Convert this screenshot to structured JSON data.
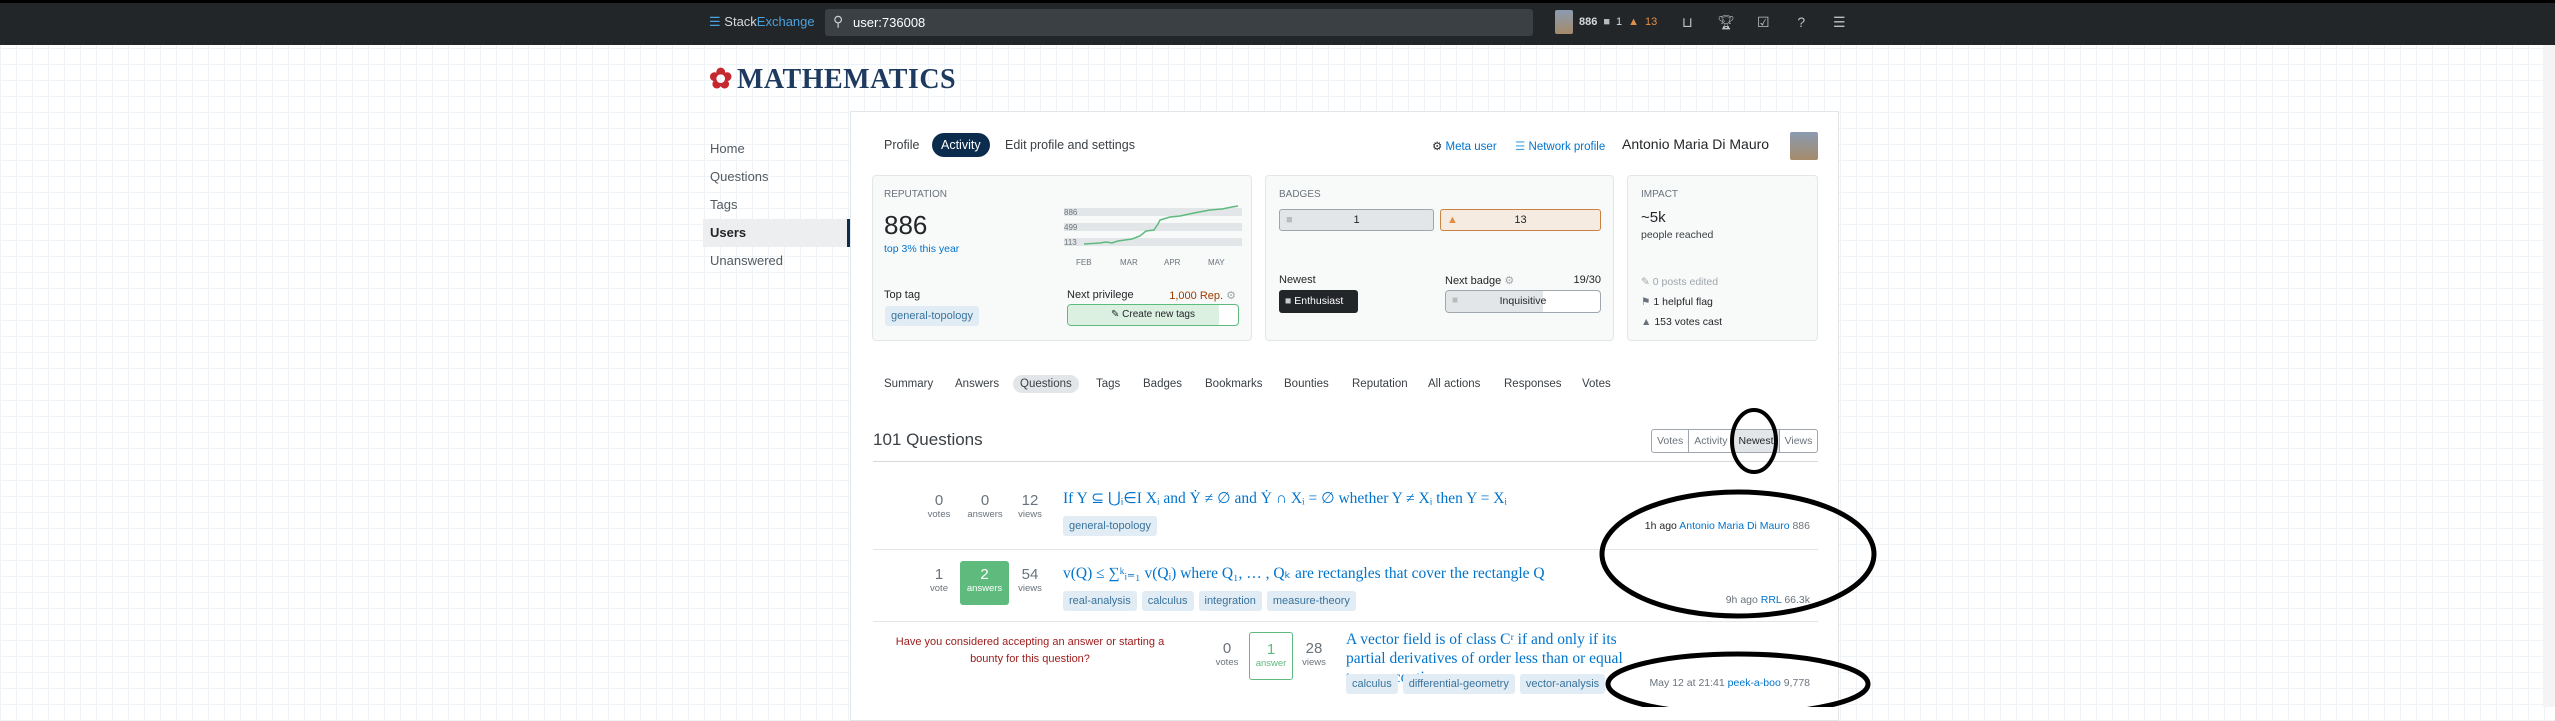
{
  "topbar": {
    "brand_a": "Stack",
    "brand_b": "Exchange",
    "search_value": "user:736008",
    "reputation": "886",
    "silver": "1",
    "bronze": "13",
    "icons": [
      "inbox-icon",
      "achievements-icon",
      "review-icon",
      "help-icon",
      "site-switcher-icon"
    ]
  },
  "site": {
    "name": "MATHEMATICS"
  },
  "nav": {
    "items": [
      {
        "label": "Home"
      },
      {
        "label": "Questions"
      },
      {
        "label": "Tags"
      },
      {
        "label": "Users",
        "selected": true
      },
      {
        "label": "Unanswered"
      }
    ]
  },
  "profile": {
    "tabs": [
      "Profile",
      "Activity",
      "Edit profile and settings"
    ],
    "active_tab": "Activity",
    "meta_user": "Meta user",
    "network_profile": "Network profile",
    "user_name": "Antonio Maria Di Mauro"
  },
  "reputation": {
    "label": "REPUTATION",
    "value": "886",
    "rank": "top 3% this year",
    "graph_y_labels": [
      "886",
      "499",
      "113"
    ],
    "graph_x_labels": [
      "FEB",
      "MAR",
      "APR",
      "MAY"
    ],
    "top_tag_label": "Top tag",
    "top_tag": "general-topology",
    "next_privilege_label": "Next privilege",
    "next_privilege_rep": "1,000 Rep.",
    "next_privilege": "Create new tags",
    "privilege_progress": 0.886
  },
  "badges": {
    "label": "BADGES",
    "silver": "1",
    "bronze": "13",
    "newest_label": "Newest",
    "newest": "Enthusiast",
    "next_badge_label": "Next badge",
    "next_badge_progress_text": "19/30",
    "next_badge": "Inquisitive",
    "next_badge_progress": 0.633
  },
  "impact": {
    "label": "IMPACT",
    "reached": "~5k",
    "reached_label": "people reached",
    "posts_edited": "0 posts edited",
    "helpful_flags": "1 helpful flag",
    "votes_cast": "153 votes cast"
  },
  "subtabs": {
    "items": [
      "Summary",
      "Answers",
      "Questions",
      "Tags",
      "Badges",
      "Bookmarks",
      "Bounties",
      "Reputation",
      "All actions",
      "Responses",
      "Votes"
    ],
    "active": "Questions"
  },
  "questions": {
    "count_label": "101 Questions",
    "sort": [
      "Votes",
      "Activity",
      "Newest",
      "Views"
    ],
    "sort_active": "Newest",
    "items": [
      {
        "votes": "0",
        "votes_label": "votes",
        "answers": "0",
        "answers_label": "answers",
        "views": "12",
        "views_label": "views",
        "title": "If Y ⊆ ⋃ᵢ∈I Xᵢ and Ẏ ≠ ∅ and Ẏ ∩ Xᵢ = ∅ whether Y ≠ Xᵢ then Y = Xᵢ",
        "tags": [
          "general-topology"
        ],
        "time": "1h ago",
        "user": "Antonio Maria Di Mauro",
        "user_rep": "886"
      },
      {
        "votes": "1",
        "votes_label": "vote",
        "answers": "2",
        "answers_label": "answers",
        "views": "54",
        "views_label": "views",
        "title": "v(Q) ≤ ∑ᵏᵢ₌₁ v(Qᵢ) where Q₁, … , Qₖ are rectangles that cover the rectangle Q",
        "tags": [
          "real-analysis",
          "calculus",
          "integration",
          "measure-theory"
        ],
        "time": "9h ago",
        "user": "RRL",
        "user_rep": "66.3k"
      },
      {
        "notice": "Have you considered accepting an answer or starting a bounty for this question?",
        "votes": "0",
        "votes_label": "votes",
        "answers": "1",
        "answers_label": "answer",
        "views": "28",
        "views_label": "views",
        "title": "A vector field is of class Cʳ if and only if its partial derivatives of order less than or equal to r are continuous.",
        "tags": [
          "calculus",
          "differential-geometry",
          "vector-analysis"
        ],
        "time": "May 12 at 21:41",
        "user": "peek-a-boo",
        "user_rep": "9,778"
      }
    ]
  },
  "colors": {
    "accent": "#0c2c4e",
    "answered": "#5eba7d",
    "link": "#0074cc",
    "bronze": "#e08e45",
    "notice": "#9c1a1a"
  }
}
